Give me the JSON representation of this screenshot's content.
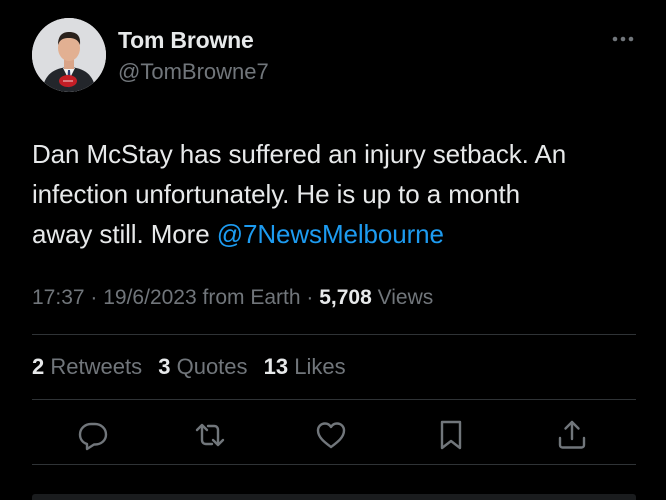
{
  "author": {
    "display_name": "Tom Browne",
    "handle": "@TomBrowne7",
    "avatar_icon": "profile-photo"
  },
  "tweet": {
    "text_line1": "Dan McStay has suffered an injury setback.  An",
    "text_line2": "infection unfortunately. He is up to a month",
    "text_line3_prefix": "away still. More ",
    "mention": "@7NewsMelbourne"
  },
  "meta": {
    "time": "17:37",
    "sep1": " · ",
    "date": "19/6/2023",
    "source": " from Earth",
    "sep2": " · ",
    "views_count": "5,708",
    "views_label": " Views"
  },
  "stats": {
    "retweets_count": "2",
    "retweets_label": "Retweets",
    "quotes_count": "3",
    "quotes_label": "Quotes",
    "likes_count": "13",
    "likes_label": "Likes"
  },
  "actions": [
    "reply-icon",
    "retweet-icon",
    "like-icon",
    "bookmark-icon",
    "share-icon"
  ],
  "colors": {
    "background": "#000000",
    "text": "#e7e9ea",
    "secondary": "#71767b",
    "link": "#1d9bf0",
    "divider": "#2f3336"
  }
}
